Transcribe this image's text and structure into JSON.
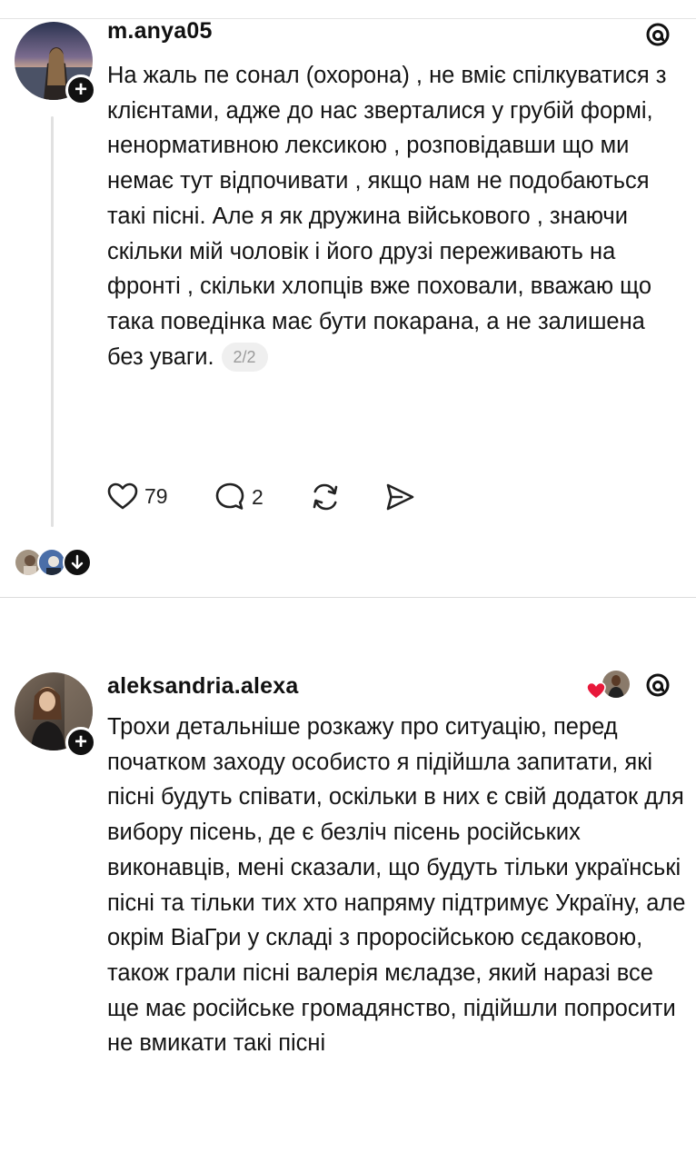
{
  "post1": {
    "username": "m.anya05",
    "text": "На жаль пе сонал (охорона) , не вміє спілкуватися з клієнтами, адже до нас зверталися у грубій формі, ненормативною лексикою , розповідавши що ми немає тут відпочивати , якщо нам не подобаються такі пісні. Але я як дружина військового , знаючи скільки мій чоловік і його друзі переживають на фронті , скільки хлопців вже поховали, вважаю що така поведінка має бути покарана, а не залишена без уваги.",
    "page_indicator": "2/2",
    "likes": "79",
    "comments": "2",
    "icons": {
      "like": "heart-outline-icon",
      "comment": "speech-bubble-icon",
      "repost": "repost-arrows-icon",
      "share": "send-paper-plane-icon",
      "brand": "threads-logo-icon",
      "follow": "plus-icon"
    }
  },
  "post2": {
    "username": "aleksandria.alexa",
    "text": "Трохи детальніше розкажу про ситуацію, перед початком заходу особисто я підійшла запитати, які пісні будуть співати, оскільки в них є свій додаток для вибору пісень, де є безліч пісень російських виконавців, мені сказали, що будуть тільки українські пісні та тільки тих хто напряму підтримує Україну, але окрім ВіаГри у складі з проросійською сєдаковою, також грали пісні валерія мєладзе, який наразі все ще має російське громадянство, підійшли попросити не вмикати такі пісні",
    "icons": {
      "liked_by_author": "heart-filled-icon",
      "brand": "threads-logo-icon",
      "follow": "plus-icon"
    }
  },
  "colors": {
    "text": "#141414",
    "muted": "#9a9a9a",
    "heart_red": "#e8183a",
    "divider": "#e1e1e1"
  }
}
